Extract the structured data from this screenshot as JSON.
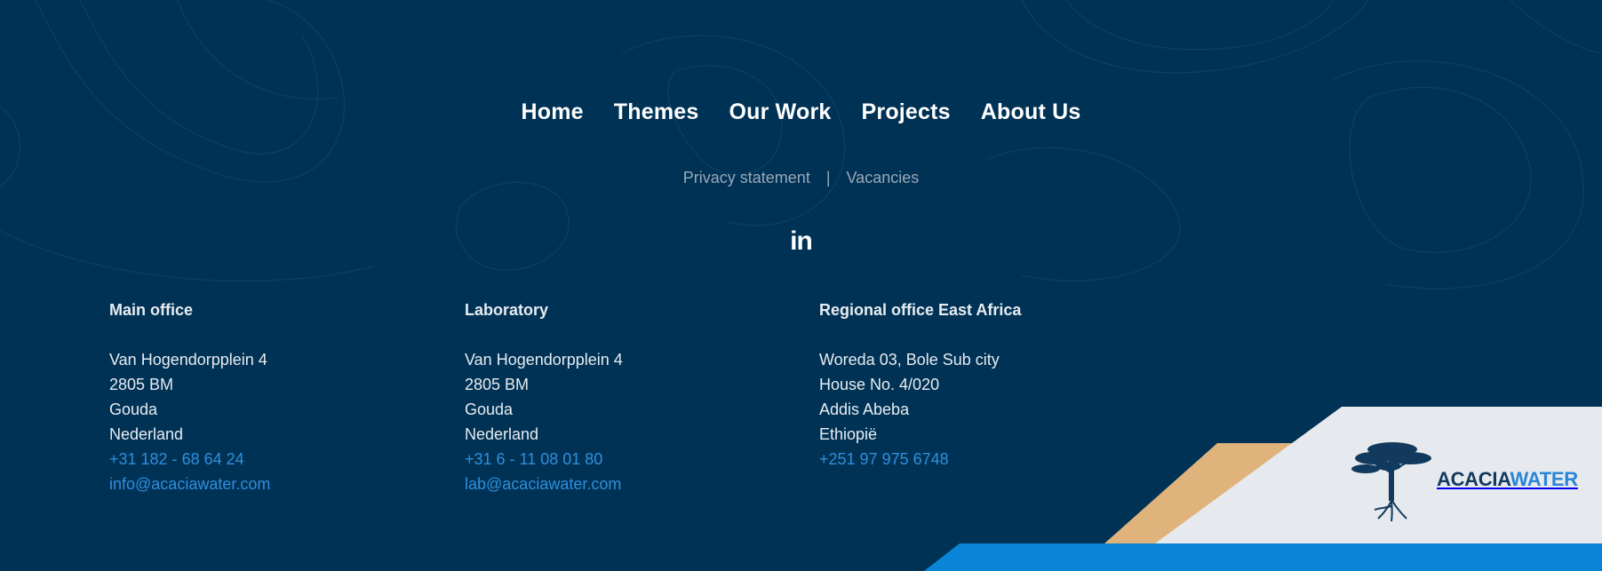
{
  "nav": {
    "items": [
      "Home",
      "Themes",
      "Our Work",
      "Projects",
      "About Us"
    ]
  },
  "sublinks": {
    "privacy": "Privacy statement",
    "separator": "|",
    "vacancies": "Vacancies"
  },
  "social": {
    "linkedin_label": "in",
    "icon": "linkedin-icon"
  },
  "offices": [
    {
      "title": "Main office",
      "lines": [
        "Van Hogendorpplein 4",
        "2805 BM",
        "Gouda",
        "Nederland"
      ],
      "phone": "+31 182 - 68 64 24",
      "email": "info@acaciawater.com"
    },
    {
      "title": "Laboratory",
      "lines": [
        "Van Hogendorpplein 4",
        "2805 BM",
        "Gouda",
        "Nederland"
      ],
      "phone": "+31 6 - 11 08 01 80",
      "email": "lab@acaciawater.com"
    },
    {
      "title": "Regional office East Africa",
      "lines": [
        "Woreda 03, Bole Sub city",
        "House No. 4/020",
        "Addis Abeba",
        "Ethiopië"
      ],
      "phone": "+251 97 975 6748"
    }
  ],
  "logo": {
    "part1": "ACACIA",
    "part2": "WATER",
    "icon": "acacia-tree-icon"
  },
  "colors": {
    "background": "#003255",
    "link": "#2f8fdc",
    "accent_tan": "#e0b37c",
    "accent_blue": "#0a84d6",
    "panel": "#e6eaee"
  }
}
